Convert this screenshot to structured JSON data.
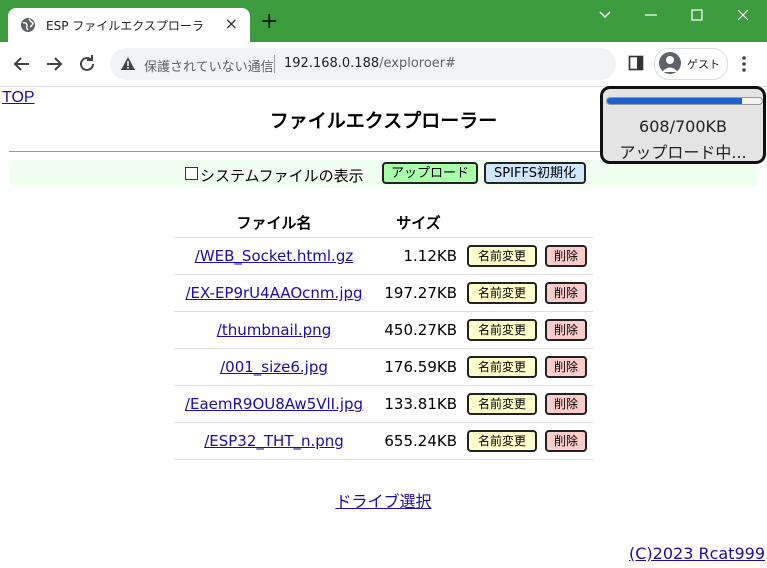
{
  "browser": {
    "tab_title": "ESP ファイルエクスプローラ",
    "tab_close": "×",
    "new_tab": "+",
    "security_text": "保護されていない通信",
    "url_host": "192.168.0.188",
    "url_path": "/exploroer#",
    "profile_label": "ゲスト",
    "accent_color": "#3c9b3c"
  },
  "page": {
    "top_link": "TOP",
    "title": "ファイルエクスプローラー",
    "system_files_label": "システムファイルの表示",
    "upload_button": "アップロード",
    "spiffs_button": "SPIFFS初期化",
    "table_headers": {
      "name": "ファイル名",
      "size": "サイズ"
    },
    "files": [
      {
        "name": "/WEB_Socket.html.gz",
        "size": "1.12KB",
        "rename": "名前変更",
        "delete": "削除"
      },
      {
        "name": "/EX-EP9rU4AAOcnm.jpg",
        "size": "197.27KB",
        "rename": "名前変更",
        "delete": "削除"
      },
      {
        "name": "/thumbnail.png",
        "size": "450.27KB",
        "rename": "名前変更",
        "delete": "削除"
      },
      {
        "name": "/001_size6.jpg",
        "size": "176.59KB",
        "rename": "名前変更",
        "delete": "削除"
      },
      {
        "name": "/EaemR9OU8Aw5VlI.jpg",
        "size": "133.81KB",
        "rename": "名前変更",
        "delete": "削除"
      },
      {
        "name": "/ESP32_THT_n.png",
        "size": "655.24KB",
        "rename": "名前変更",
        "delete": "削除"
      }
    ],
    "drive_select": "ドライブ選択",
    "copyright": "(C)2023 Rcat999"
  },
  "upload_progress": {
    "size_text": "608/700KB",
    "status_text": "アップロード中...",
    "fraction": 0.87,
    "bar_color": "#1e62d0"
  }
}
